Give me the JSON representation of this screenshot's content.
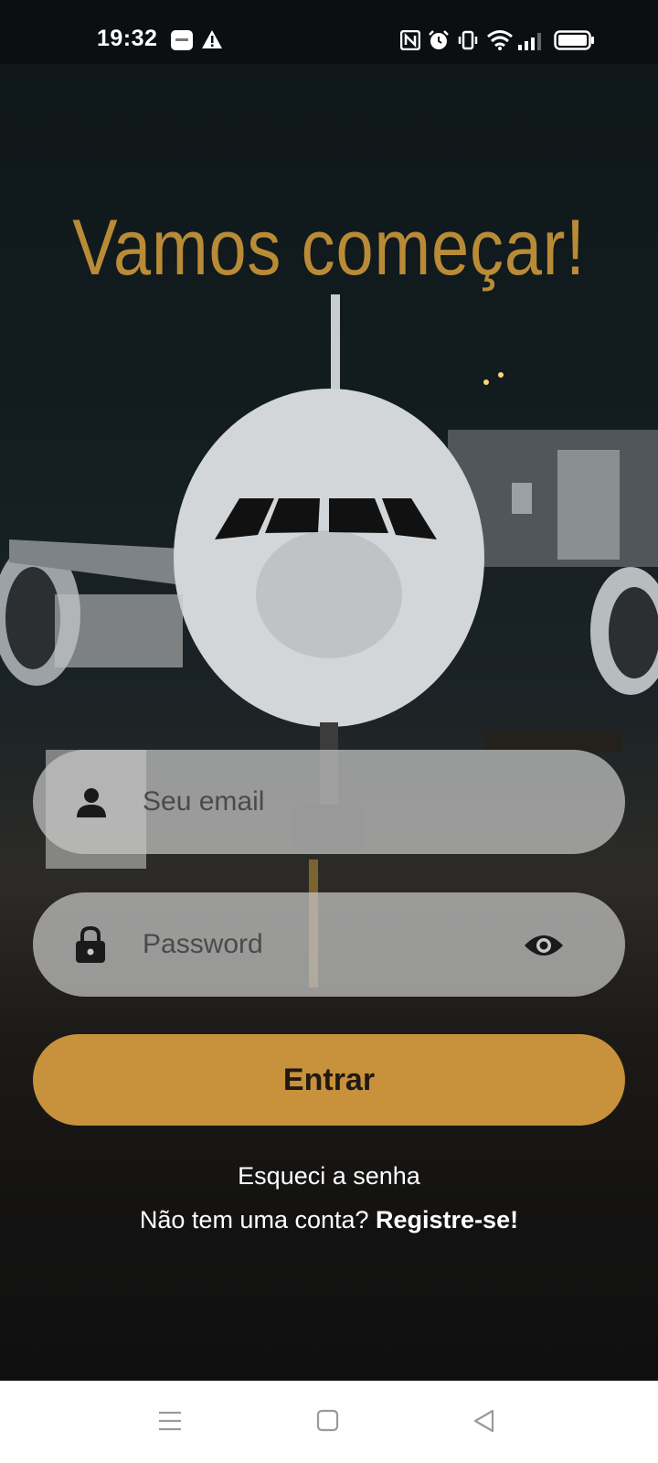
{
  "status_bar": {
    "time": "19:32",
    "icons": [
      "notification-app-icon",
      "warning-icon",
      "nfc-icon",
      "alarm-icon",
      "vibrate-icon",
      "wifi-icon",
      "signal-icon",
      "battery-icon"
    ]
  },
  "page": {
    "title": "Vamos começar!",
    "background": "night-airport-airplane-photo"
  },
  "form": {
    "email_placeholder": "Seu email",
    "password_placeholder": "Password",
    "submit_label": "Entrar"
  },
  "links": {
    "forgot_password": "Esqueci a senha",
    "no_account_prefix": "Não tem uma conta? ",
    "register": "Registre-se!"
  },
  "navigation_bar": {
    "buttons": [
      "menu-icon",
      "home-icon",
      "back-icon"
    ]
  },
  "colors": {
    "accent": "#c7923b",
    "title": "#b98b37",
    "input_background": "#c8c8c8",
    "dark_background": "#111111"
  }
}
